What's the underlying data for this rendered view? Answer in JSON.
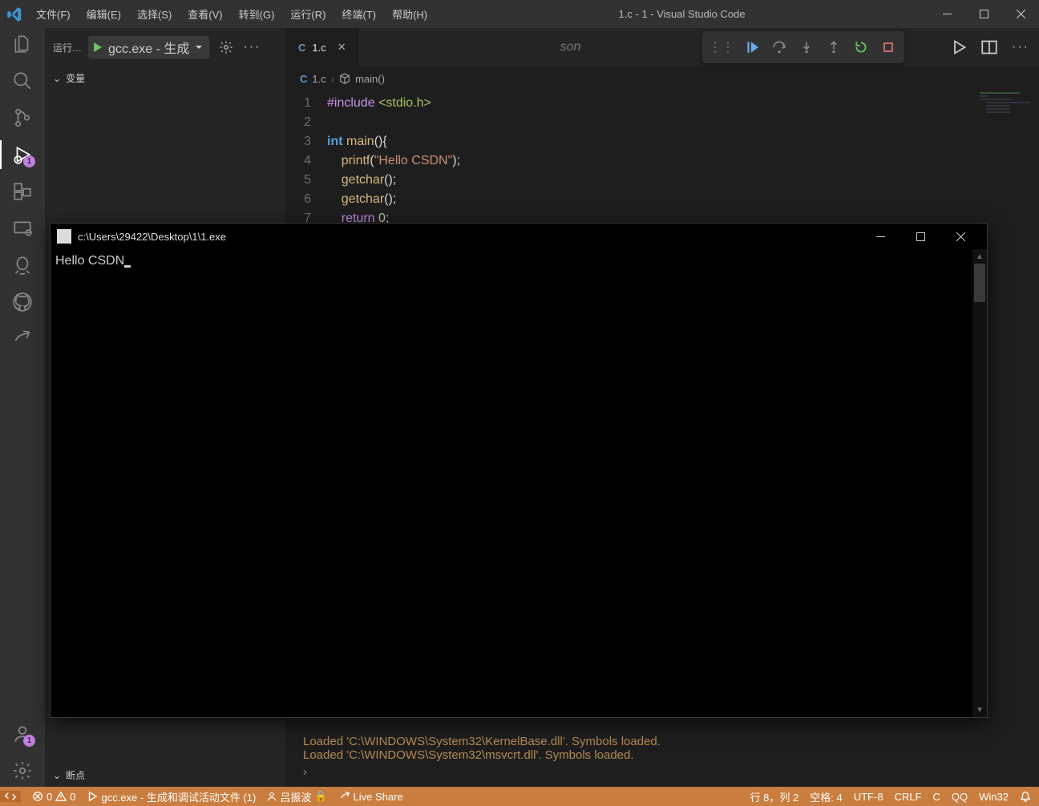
{
  "window_title": "1.c - 1 - Visual Studio Code",
  "menu": [
    "文件(F)",
    "编辑(E)",
    "选择(S)",
    "查看(V)",
    "转到(G)",
    "运行(R)",
    "终端(T)",
    "帮助(H)"
  ],
  "side": {
    "header_label": "运行…",
    "config_label": "gcc.exe - 生成",
    "section_vars": "变量",
    "section_breakpoints": "断点"
  },
  "tabs": {
    "active_file": "1.c",
    "hidden_tab_partial": "son"
  },
  "breadcrumb": {
    "file": "1.c",
    "symbol": "main()"
  },
  "code_lines": [
    {
      "n": "1",
      "html": "<span class='tk-pp'>#include</span> <span class='tk-inc'>&lt;stdio.h&gt;</span>"
    },
    {
      "n": "2",
      "html": ""
    },
    {
      "n": "3",
      "html": "<span class='tk-type'>int</span> <span class='tk-fn'>main</span><span class='tk-pun'>(){</span>"
    },
    {
      "n": "4",
      "html": "    <span class='tk-fn'>printf</span><span class='tk-pun'>(</span><span class='tk-str'>\"Hello CSDN\"</span><span class='tk-pun'>);</span>"
    },
    {
      "n": "5",
      "html": "    <span class='tk-fn'>getchar</span><span class='tk-pun'>();</span>"
    },
    {
      "n": "6",
      "html": "    <span class='tk-fn'>getchar</span><span class='tk-pun'>();</span>"
    },
    {
      "n": "7",
      "html": "    <span class='tk-pp'>return</span> <span class='tk-num'>0</span><span class='tk-pun'>;</span>"
    }
  ],
  "debug_console": {
    "line1": "Loaded 'C:\\WINDOWS\\System32\\KernelBase.dll'. Symbols loaded.",
    "line2": "Loaded 'C:\\WINDOWS\\System32\\msvcrt.dll'. Symbols loaded."
  },
  "status": {
    "errors": "0",
    "warnings": "0",
    "task": "gcc.exe - 生成和调试活动文件 (1)",
    "user": "吕振波",
    "liveshare": "Live Share",
    "cursor_pos": "行 8，列 2",
    "spaces": "空格: 4",
    "encoding": "UTF-8",
    "eol": "CRLF",
    "lang": "C",
    "qq": "QQ",
    "platform": "Win32"
  },
  "console_window": {
    "title": "c:\\Users\\29422\\Desktop\\1\\1.exe",
    "output": "Hello CSDN"
  },
  "debug_badge": "1",
  "accounts_badge": "1"
}
